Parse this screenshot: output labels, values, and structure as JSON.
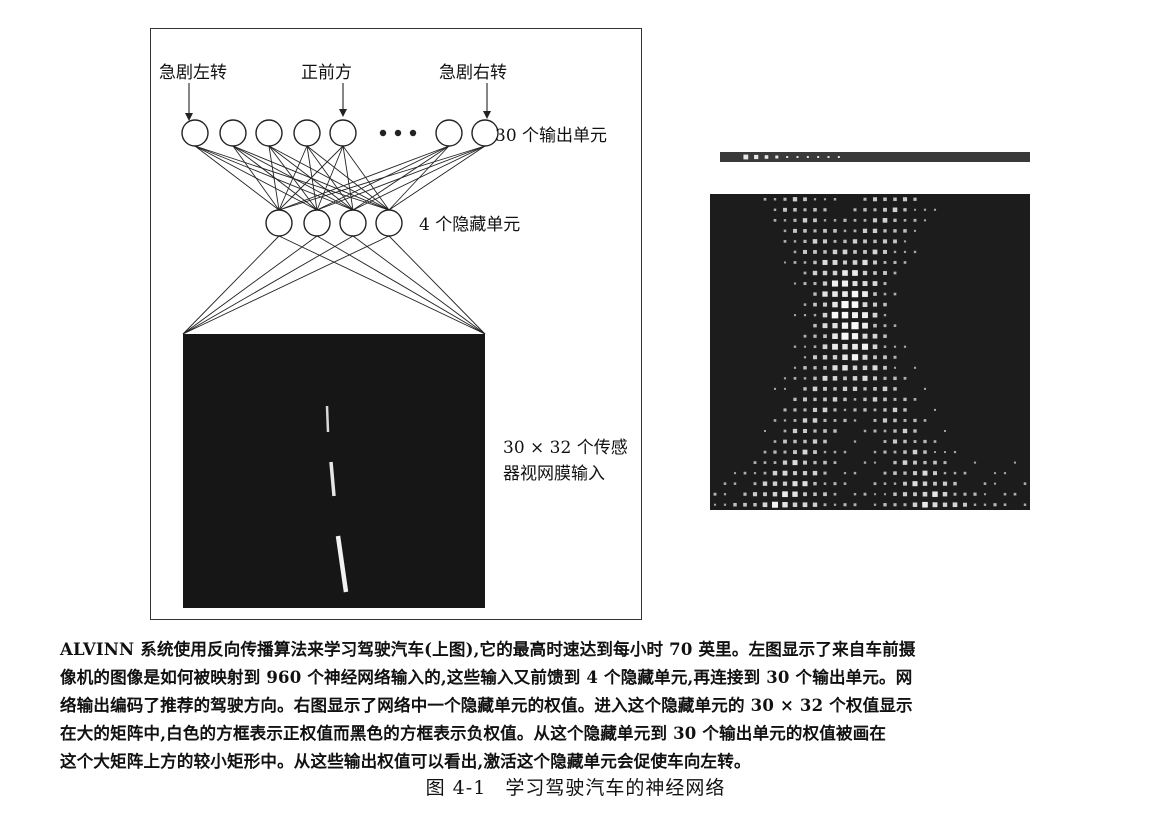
{
  "figure": {
    "output_labels": {
      "sharp_left": "急剧左转",
      "straight_ahead": "正前方",
      "sharp_right": "急剧右转"
    },
    "output_units_label": "30 个输出单元",
    "hidden_units_label": "4 个隐藏单元",
    "input_label_line1": "30 × 32 个传感",
    "input_label_line2": "器视网膜输入",
    "ellipsis": "●●●"
  },
  "caption": {
    "lines": [
      "ALVINN 系统使用反向传播算法来学习驾驶汽车(上图),它的最高时速达到每小时 70 英里。左图显示了来自车前摄",
      "像机的图像是如何被映射到 960 个神经网络输入的,这些输入又前馈到 4 个隐藏单元,再连接到 30 个输出单元。网",
      "络输出编码了推荐的驾驶方向。右图显示了网络中一个隐藏单元的权值。进入这个隐藏单元的 30 × 32 个权值显示",
      "在大的矩阵中,白色的方框表示正权值而黑色的方框表示负权值。从这个隐藏单元到 30 个输出单元的权值被画在",
      "这个大矩阵上方的较小矩形中。从这些输出权值可以看出,激活这个隐藏单元会促使车向左转。"
    ],
    "figure_number": "图 4-1",
    "figure_title": "学习驾驶汽车的神经网络"
  }
}
